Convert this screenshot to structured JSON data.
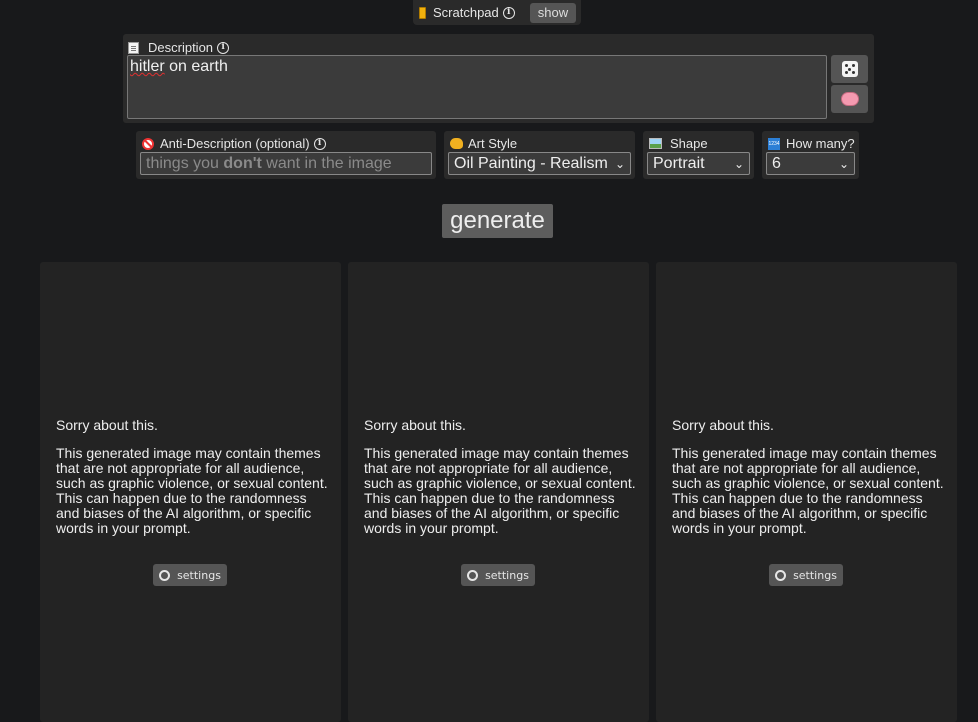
{
  "scratchpad": {
    "label": "Scratchpad",
    "show_label": "show"
  },
  "description": {
    "label": "Description",
    "value_misspelled": "hitler",
    "value_rest": " on earth"
  },
  "anti_description": {
    "label": "Anti-Description (optional)",
    "placeholder_before": "things you ",
    "placeholder_bold": "don't",
    "placeholder_after": " want in the image"
  },
  "art_style": {
    "label": "Art Style",
    "selected": "Oil Painting - Realism"
  },
  "shape": {
    "label": "Shape",
    "selected": "Portrait"
  },
  "how_many": {
    "label": "How many?",
    "selected": "6"
  },
  "generate_label": "generate",
  "cards": [
    {
      "sorry": "Sorry about this.",
      "message": "This generated image may contain themes that are not appropriate for all audience, such as graphic violence, or sexual content. This can happen due to the randomness and biases of the AI algorithm, or specific words in your prompt.",
      "settings_label": "settings"
    },
    {
      "sorry": "Sorry about this.",
      "message": "This generated image may contain themes that are not appropriate for all audience, such as graphic violence, or sexual content. This can happen due to the randomness and biases of the AI algorithm, or specific words in your prompt.",
      "settings_label": "settings"
    },
    {
      "sorry": "Sorry about this.",
      "message": "This generated image may contain themes that are not appropriate for all audience, such as graphic violence, or sexual content. This can happen due to the randomness and biases of the AI algorithm, or specific words in your prompt.",
      "settings_label": "settings"
    }
  ]
}
